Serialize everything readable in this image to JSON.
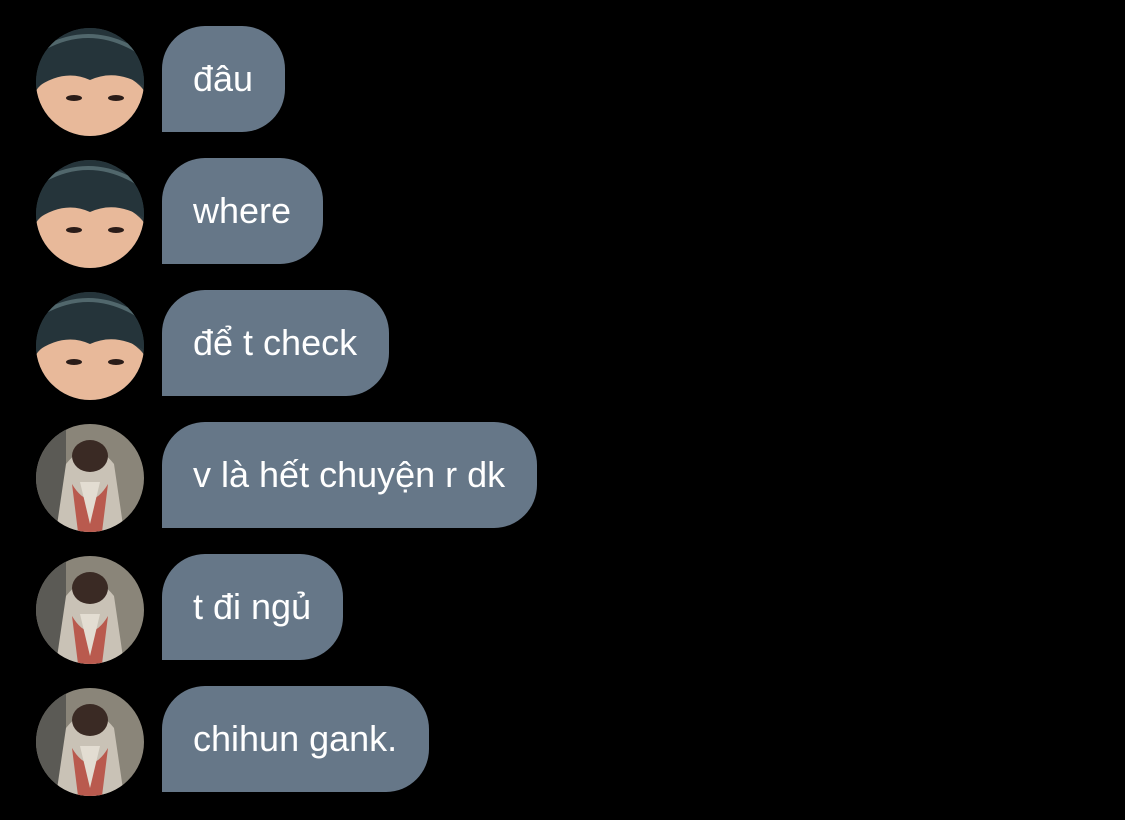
{
  "colors": {
    "background": "#000000",
    "bubble": "#667788",
    "text": "#ffffff"
  },
  "messages": [
    {
      "sender": "contact-a",
      "avatar_icon": "contact-a-avatar",
      "text": "đâu"
    },
    {
      "sender": "contact-a",
      "avatar_icon": "contact-a-avatar",
      "text": "where"
    },
    {
      "sender": "contact-a",
      "avatar_icon": "contact-a-avatar",
      "text": "để t check"
    },
    {
      "sender": "contact-b",
      "avatar_icon": "contact-b-avatar",
      "text": "v là hết chuyện r dk"
    },
    {
      "sender": "contact-b",
      "avatar_icon": "contact-b-avatar",
      "text": "t đi ngủ"
    },
    {
      "sender": "contact-b",
      "avatar_icon": "contact-b-avatar",
      "text": "chihun gank."
    }
  ]
}
